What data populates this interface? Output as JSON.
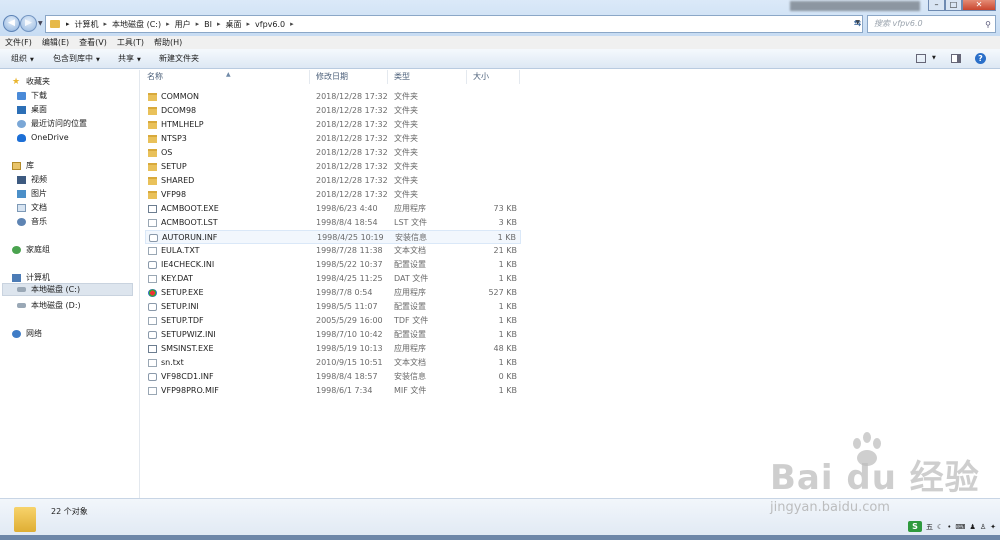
{
  "breadcrumb": [
    "计算机",
    "本地磁盘 (C:)",
    "用户",
    "BI",
    "桌面",
    "vfpv6.0"
  ],
  "search": {
    "placeholder": "搜索 vfpv6.0"
  },
  "menu": [
    "文件(F)",
    "编辑(E)",
    "查看(V)",
    "工具(T)",
    "帮助(H)"
  ],
  "commands": {
    "organize": "组织",
    "include_library": "包含到库中",
    "share": "共享",
    "new_folder": "新建文件夹"
  },
  "columns": {
    "name": "名称",
    "date": "修改日期",
    "type": "类型",
    "size": "大小"
  },
  "nav": {
    "favorites": "收藏夹",
    "downloads": "下载",
    "desktop": "桌面",
    "recent": "最近访问的位置",
    "onedrive": "OneDrive",
    "libraries": "库",
    "videos": "视频",
    "pictures": "图片",
    "documents": "文档",
    "music": "音乐",
    "homegroup": "家庭组",
    "computer": "计算机",
    "drive_c": "本地磁盘 (C:)",
    "drive_d": "本地磁盘 (D:)",
    "network": "网络"
  },
  "files": [
    {
      "name": "COMMON",
      "date": "2018/12/28 17:32",
      "type": "文件夹",
      "size": "",
      "icon": "folder-icon"
    },
    {
      "name": "DCOM98",
      "date": "2018/12/28 17:32",
      "type": "文件夹",
      "size": "",
      "icon": "folder-icon"
    },
    {
      "name": "HTMLHELP",
      "date": "2018/12/28 17:32",
      "type": "文件夹",
      "size": "",
      "icon": "folder-icon"
    },
    {
      "name": "NTSP3",
      "date": "2018/12/28 17:32",
      "type": "文件夹",
      "size": "",
      "icon": "folder-icon"
    },
    {
      "name": "OS",
      "date": "2018/12/28 17:32",
      "type": "文件夹",
      "size": "",
      "icon": "folder-icon"
    },
    {
      "name": "SETUP",
      "date": "2018/12/28 17:32",
      "type": "文件夹",
      "size": "",
      "icon": "folder-icon"
    },
    {
      "name": "SHARED",
      "date": "2018/12/28 17:32",
      "type": "文件夹",
      "size": "",
      "icon": "folder-icon"
    },
    {
      "name": "VFP98",
      "date": "2018/12/28 17:32",
      "type": "文件夹",
      "size": "",
      "icon": "folder-icon"
    },
    {
      "name": "ACMBOOT.EXE",
      "date": "1998/6/23 4:40",
      "type": "应用程序",
      "size": "73 KB",
      "icon": "exe-icon"
    },
    {
      "name": "ACMBOOT.LST",
      "date": "1998/8/4 18:54",
      "type": "LST 文件",
      "size": "3 KB",
      "icon": "file-icon"
    },
    {
      "name": "AUTORUN.INF",
      "date": "1998/4/25 10:19",
      "type": "安装信息",
      "size": "1 KB",
      "icon": "settings-file-icon"
    },
    {
      "name": "EULA.TXT",
      "date": "1998/7/28 11:38",
      "type": "文本文档",
      "size": "21 KB",
      "icon": "file-icon"
    },
    {
      "name": "IE4CHECK.INI",
      "date": "1998/5/22 10:37",
      "type": "配置设置",
      "size": "1 KB",
      "icon": "settings-file-icon"
    },
    {
      "name": "KEY.DAT",
      "date": "1998/4/25 11:25",
      "type": "DAT 文件",
      "size": "1 KB",
      "icon": "file-icon"
    },
    {
      "name": "SETUP.EXE",
      "date": "1998/7/8 0:54",
      "type": "应用程序",
      "size": "527 KB",
      "icon": "setup-icon"
    },
    {
      "name": "SETUP.INI",
      "date": "1998/5/5 11:07",
      "type": "配置设置",
      "size": "1 KB",
      "icon": "settings-file-icon"
    },
    {
      "name": "SETUP.TDF",
      "date": "2005/5/29 16:00",
      "type": "TDF 文件",
      "size": "1 KB",
      "icon": "file-icon"
    },
    {
      "name": "SETUPWIZ.INI",
      "date": "1998/7/10 10:42",
      "type": "配置设置",
      "size": "1 KB",
      "icon": "settings-file-icon"
    },
    {
      "name": "SMSINST.EXE",
      "date": "1998/5/19 10:13",
      "type": "应用程序",
      "size": "48 KB",
      "icon": "exe-icon"
    },
    {
      "name": "sn.txt",
      "date": "2010/9/15 10:51",
      "type": "文本文档",
      "size": "1 KB",
      "icon": "file-icon"
    },
    {
      "name": "VF98CD1.INF",
      "date": "1998/8/4 18:57",
      "type": "安装信息",
      "size": "0 KB",
      "icon": "settings-file-icon"
    },
    {
      "name": "VFP98PRO.MIF",
      "date": "1998/6/1 7:34",
      "type": "MIF 文件",
      "size": "1 KB",
      "icon": "file-icon"
    }
  ],
  "status": {
    "count": "22 个对象"
  },
  "watermark": {
    "brand": "Bai  du 经验",
    "url": "jingyan.baidu.com"
  },
  "tray": {
    "label": "五"
  },
  "colors": {
    "folder": "#e9c15a",
    "accent": "#2a6fc9",
    "selected": "#dde5ee"
  }
}
